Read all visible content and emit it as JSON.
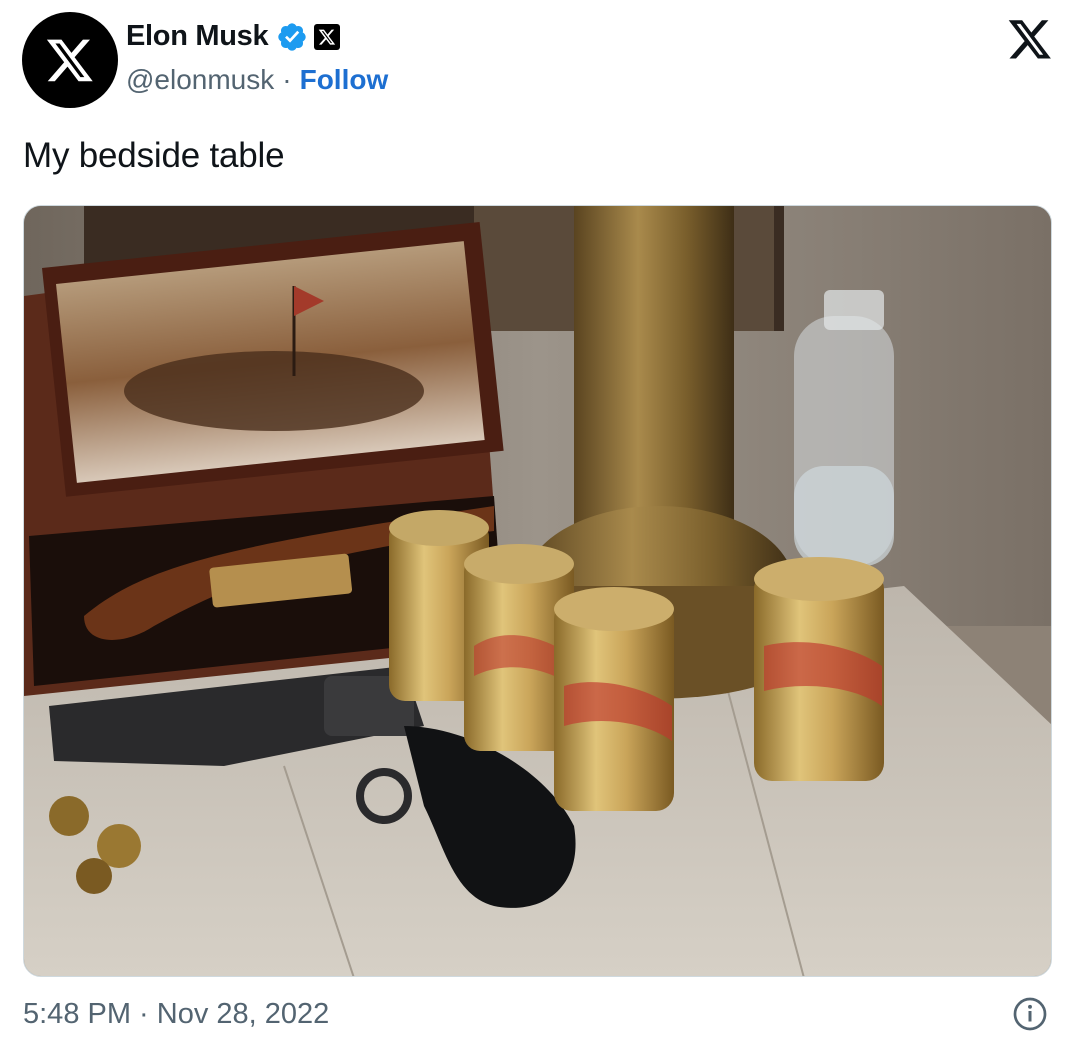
{
  "author": {
    "name": "Elon Musk",
    "handle": "@elonmusk",
    "follow_label": "Follow",
    "separator": "·",
    "avatar_icon": "x-logo-icon",
    "verified_icon": "verified-badge-icon",
    "affiliation_icon": "x-affiliation-icon"
  },
  "header": {
    "logo_icon": "x-logo-icon"
  },
  "tweet": {
    "text": "My bedside table",
    "media": {
      "description_icon": "photo"
    },
    "timestamp": "5:48 PM · Nov 28, 2022"
  },
  "footer": {
    "info_icon": "info-icon"
  },
  "colors": {
    "follow": "#1d6fd1",
    "verified": "#1d9bf0",
    "secondary_text": "#536471",
    "primary_text": "#0f1419"
  }
}
